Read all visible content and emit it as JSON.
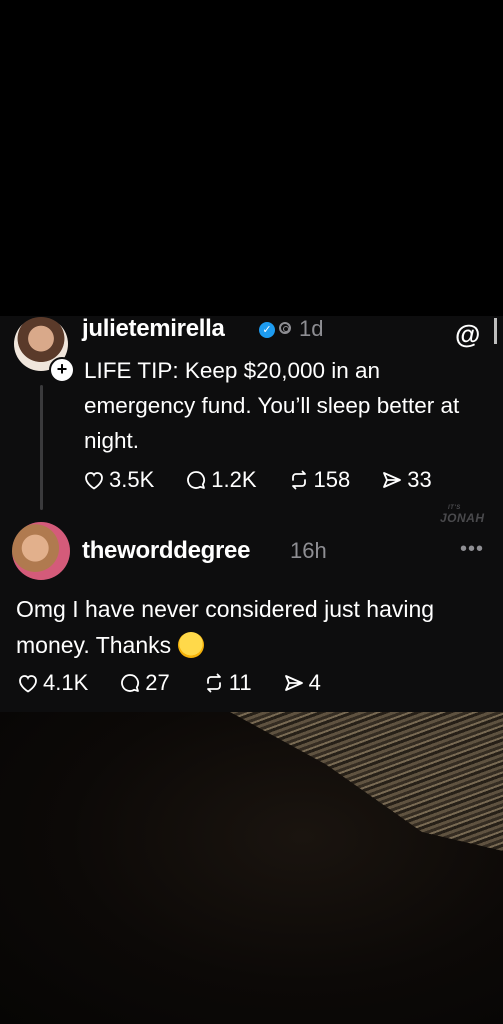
{
  "post": {
    "username": "julietemirella",
    "time": "1d",
    "text": "LIFE TIP: Keep $20,000 in an emergency fund. You’ll sleep better at night.",
    "likes": "3.5K",
    "replies": "1.2K",
    "reposts": "158",
    "shares": "33",
    "verified": true
  },
  "reply": {
    "username": "theworddegree",
    "time": "16h",
    "text": "Omg I have never considered just having money. Thanks",
    "likes": "4.1K",
    "replies": "27",
    "reposts": "11",
    "shares": "4"
  },
  "watermark": {
    "small": "IT'S",
    "main": "JONAH"
  },
  "colors": {
    "background": "#0d0d0e",
    "muted": "#8e8e93",
    "verified": "#1d9bf0",
    "text": "#ffffff"
  },
  "icons": [
    "heart-icon",
    "comment-icon",
    "repost-icon",
    "send-icon",
    "threads-logo-icon",
    "more-icon",
    "laughing-emoji"
  ]
}
